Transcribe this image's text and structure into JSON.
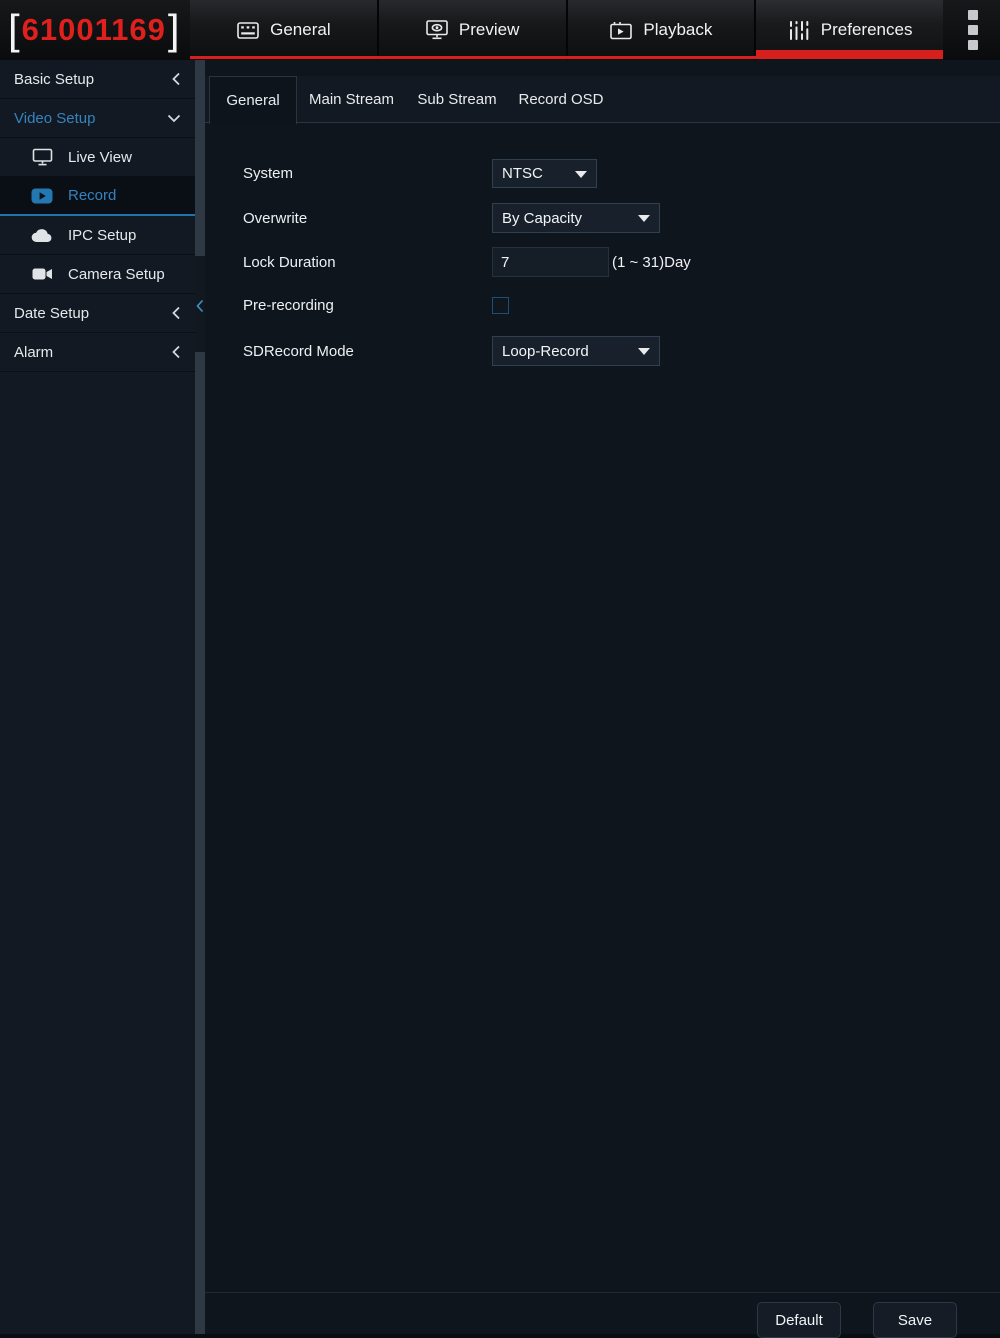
{
  "header": {
    "device_id": {
      "bracket_open": "[",
      "number": "61001169",
      "bracket_close": "]"
    },
    "tabs": [
      {
        "label": "General",
        "icon": "grid-icon",
        "active": false
      },
      {
        "label": "Preview",
        "icon": "monitor-eye-icon",
        "active": false
      },
      {
        "label": "Playback",
        "icon": "playback-icon",
        "active": false
      },
      {
        "label": "Preferences",
        "icon": "sliders-icon",
        "active": true
      }
    ]
  },
  "sidebar": {
    "groups": [
      {
        "label": "Basic Setup",
        "state": "collapsed"
      },
      {
        "label": "Video Setup",
        "state": "expanded",
        "active": true
      },
      {
        "label": "Date Setup",
        "state": "collapsed"
      },
      {
        "label": "Alarm",
        "state": "collapsed"
      }
    ],
    "video_children": [
      {
        "label": "Live View",
        "icon": "monitor-icon",
        "active": false
      },
      {
        "label": "Record",
        "icon": "record-play-icon",
        "active": true
      },
      {
        "label": "IPC Setup",
        "icon": "cloud-icon",
        "active": false
      },
      {
        "label": "Camera Setup",
        "icon": "camera-icon",
        "active": false
      }
    ]
  },
  "content": {
    "tabs": [
      {
        "label": "General",
        "active": true
      },
      {
        "label": "Main Stream",
        "active": false
      },
      {
        "label": "Sub Stream",
        "active": false
      },
      {
        "label": "Record OSD",
        "active": false
      }
    ],
    "form": {
      "system": {
        "label": "System",
        "value": "NTSC"
      },
      "overwrite": {
        "label": "Overwrite",
        "value": "By Capacity"
      },
      "lock_duration": {
        "label": "Lock Duration",
        "value": "7",
        "hint": "(1 ~ 31)Day"
      },
      "pre_recording": {
        "label": "Pre-recording",
        "checked": false
      },
      "sd_record_mode": {
        "label": "SDRecord Mode",
        "value": "Loop-Record"
      }
    },
    "footer": {
      "default_label": "Default",
      "save_label": "Save"
    }
  },
  "colors": {
    "accent_red": "#d7201d",
    "device_number_red": "#e0201c",
    "accent_blue": "#3583bf",
    "selected_underline": "#2273ab"
  }
}
